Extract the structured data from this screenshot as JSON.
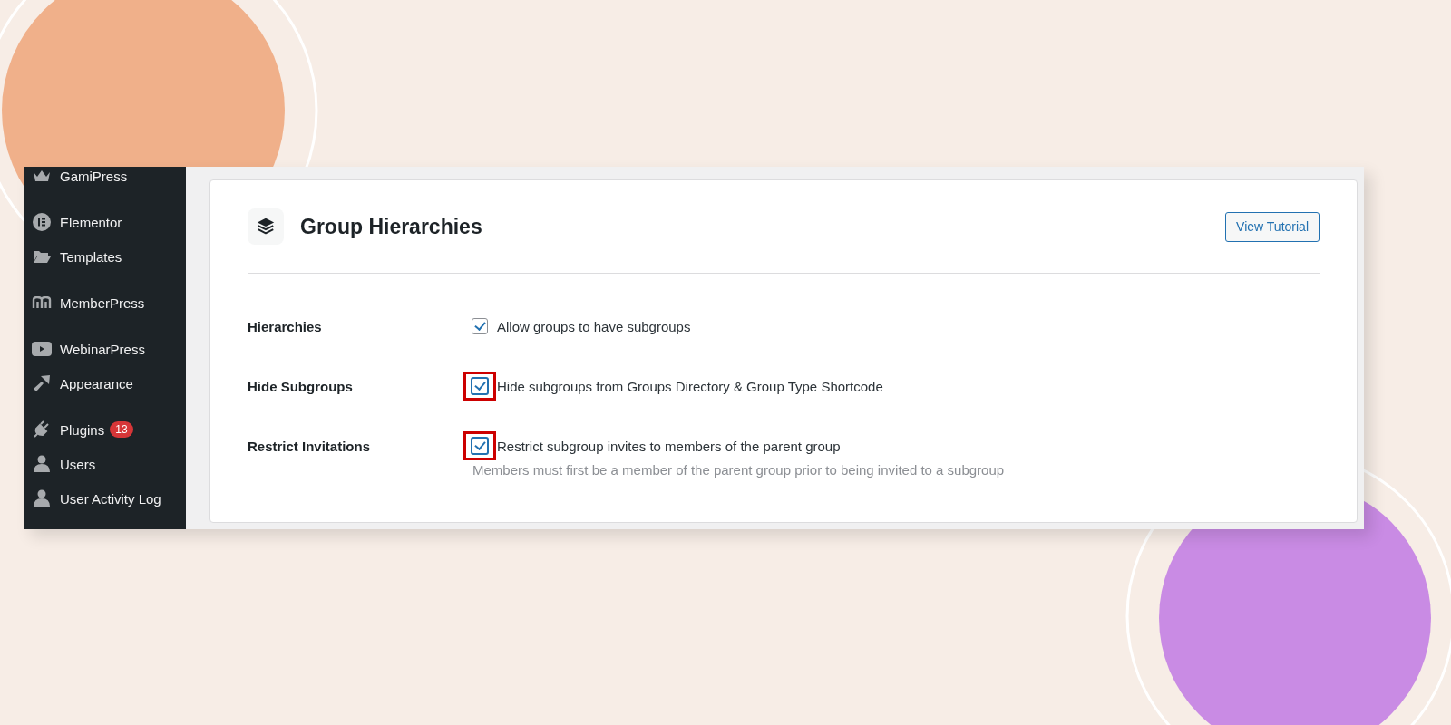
{
  "sidebar": {
    "sections": [
      {
        "items": [
          {
            "label": "GamiPress"
          }
        ]
      },
      {
        "items": [
          {
            "label": "Elementor"
          },
          {
            "label": "Templates"
          }
        ]
      },
      {
        "items": [
          {
            "label": "MemberPress"
          }
        ]
      },
      {
        "items": [
          {
            "label": "WebinarPress"
          },
          {
            "label": "Appearance"
          }
        ]
      },
      {
        "items": [
          {
            "label": "Plugins",
            "badge": "13"
          },
          {
            "label": "Users"
          },
          {
            "label": "User Activity Log"
          }
        ]
      }
    ]
  },
  "page": {
    "title": "Group Hierarchies",
    "button": "View Tutorial"
  },
  "settings": [
    {
      "label": "Hierarchies",
      "option": "Allow groups to have subgroups",
      "checked": true,
      "highlighted": false
    },
    {
      "label": "Hide Subgroups",
      "option": "Hide subgroups from Groups Directory & Group Type Shortcode",
      "checked": true,
      "highlighted": true
    },
    {
      "label": "Restrict Invitations",
      "option": "Restrict subgroup invites to members of the parent group",
      "checked": true,
      "highlighted": true,
      "description": "Members must first be a member of the parent group prior to being invited to a subgroup"
    }
  ]
}
